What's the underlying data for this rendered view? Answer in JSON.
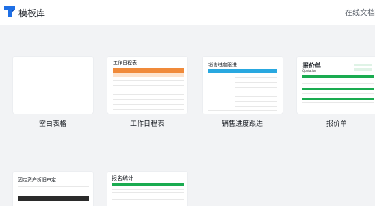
{
  "header": {
    "title": "模板库",
    "online_docs": "在线文档",
    "logo_icon": "template-library-logo-icon",
    "brand_color": "#1f6fe5"
  },
  "templates": [
    {
      "label": "空白表格"
    },
    {
      "label": "工作日程表",
      "preview_title": "工作日程表",
      "accent": "#f08a3a"
    },
    {
      "label": "销售进度跟进",
      "preview_title": "销售进度跟进",
      "accent": "#29a8e0"
    },
    {
      "label": "报价单",
      "preview_title": "报价单",
      "preview_subtitle": "Quotation",
      "accent": "#1aab50"
    },
    {
      "label": "",
      "preview_title": "固定资产折旧审定",
      "accent": "#2b2b2b"
    },
    {
      "label": "",
      "preview_title": "报名统计",
      "accent": "#1aab50"
    }
  ]
}
